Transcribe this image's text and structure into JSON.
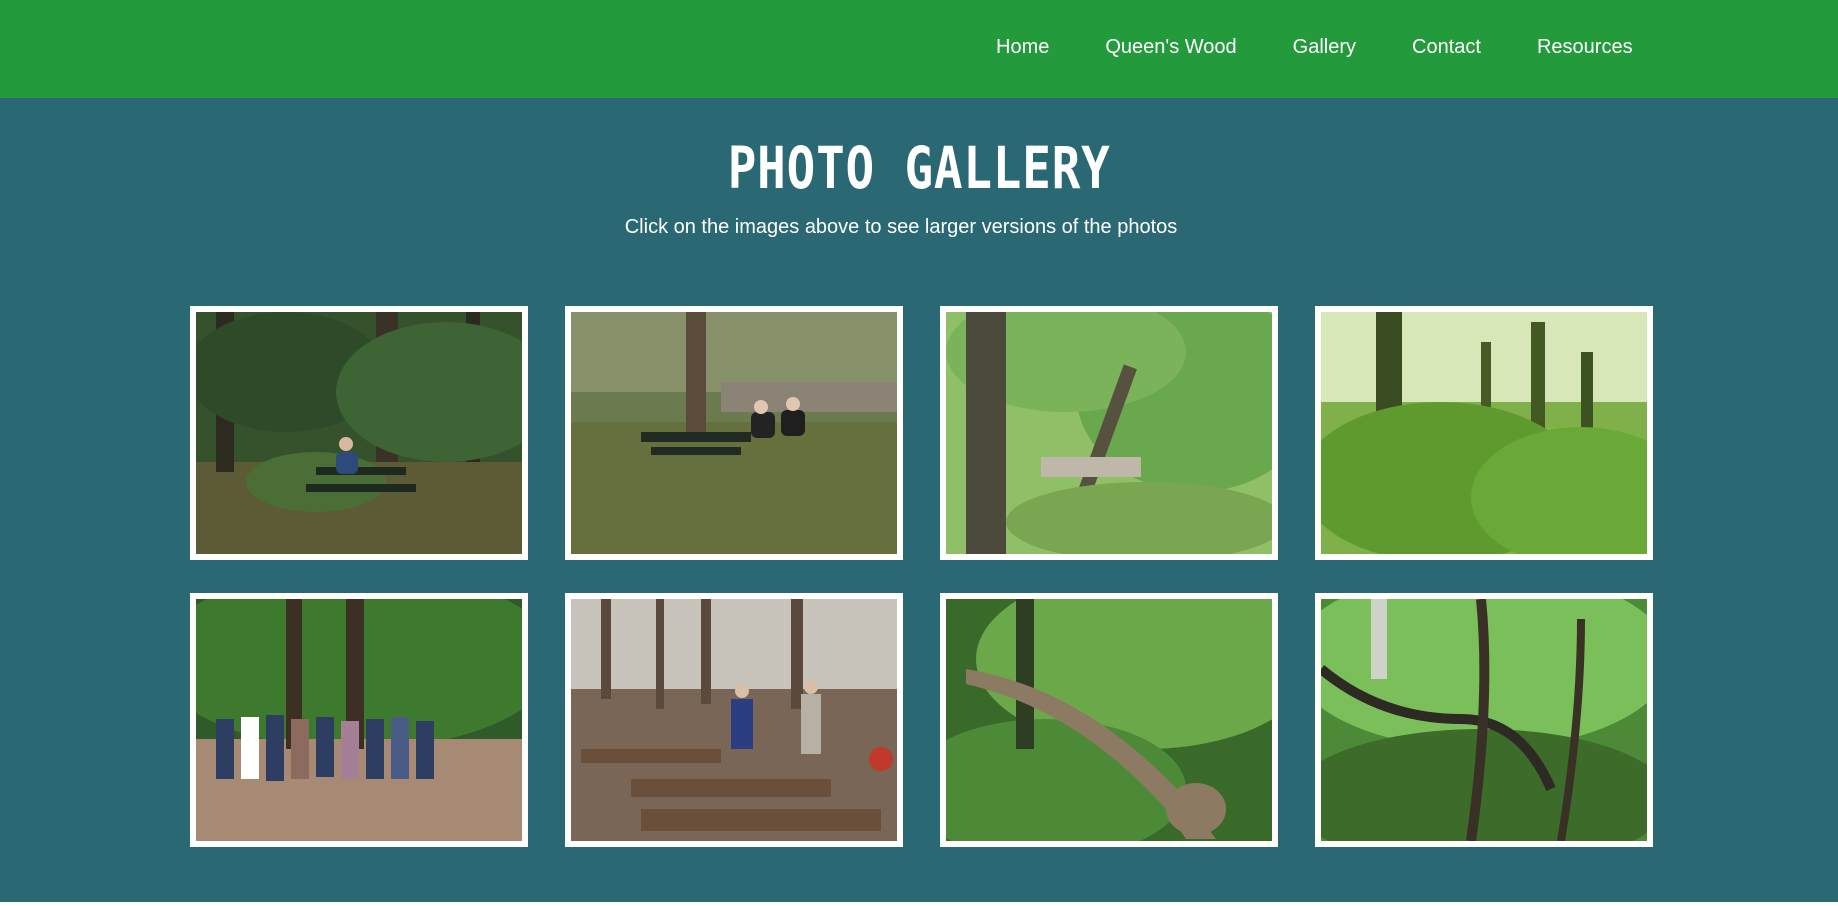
{
  "nav": {
    "items": [
      {
        "label": "Home"
      },
      {
        "label": "Queen's Wood"
      },
      {
        "label": "Gallery"
      },
      {
        "label": "Contact"
      },
      {
        "label": "Resources"
      }
    ]
  },
  "gallery": {
    "title": "Photo Gallery",
    "subtitle": "Click on the images above to see larger versions of the photos"
  },
  "colors": {
    "header": "#239a3b",
    "background": "#2a6873",
    "frame": "#ffffff"
  }
}
